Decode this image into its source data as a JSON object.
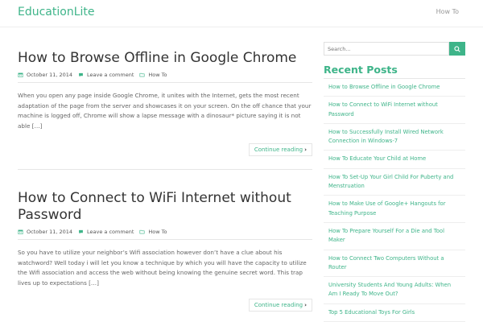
{
  "site": {
    "title": "EducationLite"
  },
  "nav": {
    "items": [
      "How To"
    ]
  },
  "posts": [
    {
      "title": "How to Browse Offline in Google Chrome",
      "date": "October 11, 2014",
      "comments": "Leave a comment",
      "category": "How To",
      "excerpt": "When you open any page inside Google Chrome, it unites with the Internet, gets the most recent adaptation of the page from the server and showcases it on your screen. On the off chance that your machine is logged off, Chrome will show a lapse message with a dinosaur* picture saying it is not able […]",
      "continue": "Continue reading"
    },
    {
      "title": "How to Connect to WiFi Internet without Password",
      "date": "October 11, 2014",
      "comments": "Leave a comment",
      "category": "How To",
      "excerpt": "So you have to utilize your neighbor’s Wifi association however don’t have a clue about his watchword? Well today i will let you know a technique by which you will have the capacity to utilize the Wifi association and access the web without being knowing the genuine secret word. This trap lives up to expectations […]",
      "continue": "Continue reading"
    }
  ],
  "sidebar": {
    "search_placeholder": "Search...",
    "recent_title": "Recent Posts",
    "recent": [
      "How to Browse Offline in Google Chrome",
      "How to Connect to WiFi Internet without Password",
      "How to Successfully Install Wired Network Connection in Windows-7",
      "How To Educate Your Child at Home",
      "How To Set-Up Your Girl Child For Puberty and Menstruation",
      "How to Make Use of Google+ Hangouts for Teaching Purpose",
      "How To Prepare Yourself For a Die and Tool Maker",
      "How to Connect Two Computers Without a Router",
      "University Students And Young Adults: When Am I Ready To Move Out?",
      "Top 5 Educational Toys For Girls"
    ]
  },
  "colors": {
    "accent": "#3eb489",
    "title": "#333333",
    "text": "#666666"
  },
  "icons": {
    "date": "calendar-icon",
    "comments": "comment-icon",
    "category": "folder-icon",
    "continue": "chevron-right-icon",
    "search": "search-icon"
  }
}
